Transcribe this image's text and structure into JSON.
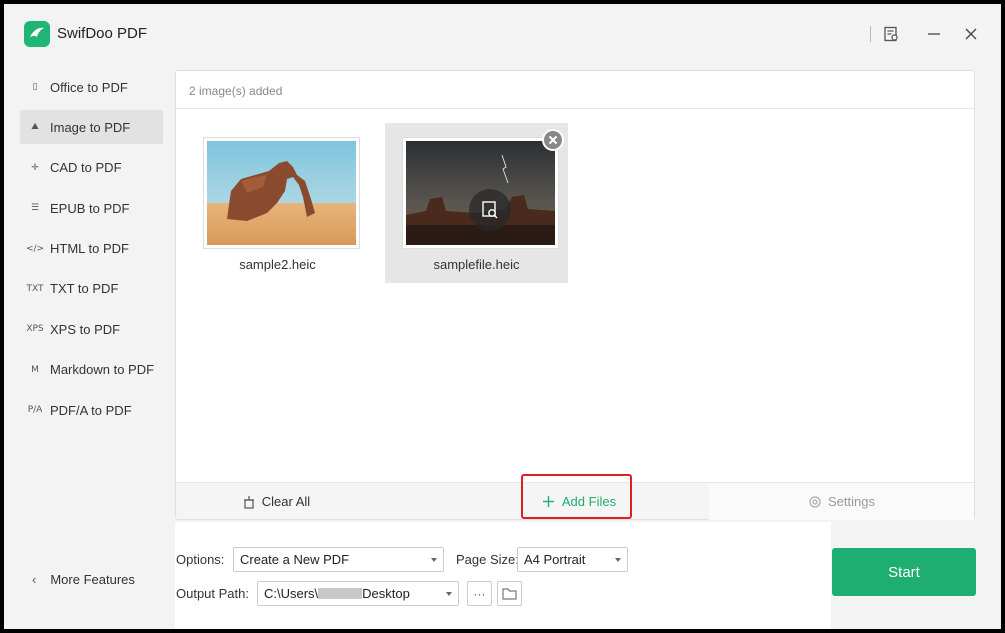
{
  "app": {
    "title": "SwifDoo PDF"
  },
  "sidebar": {
    "items": [
      {
        "icon": "office-icon",
        "glyph": "▯",
        "label": "Office to PDF"
      },
      {
        "icon": "image-icon",
        "glyph": "⛰",
        "label": "Image to PDF"
      },
      {
        "icon": "cad-icon",
        "glyph": "✛",
        "label": "CAD to PDF"
      },
      {
        "icon": "epub-icon",
        "glyph": "☰",
        "label": "EPUB to PDF"
      },
      {
        "icon": "html-icon",
        "glyph": "</>",
        "label": "HTML to PDF"
      },
      {
        "icon": "txt-icon",
        "glyph": "TXT",
        "label": "TXT to PDF"
      },
      {
        "icon": "xps-icon",
        "glyph": "XPS",
        "label": "XPS to PDF"
      },
      {
        "icon": "markdown-icon",
        "glyph": "M",
        "label": "Markdown to PDF"
      },
      {
        "icon": "pdfa-icon",
        "glyph": "P/A",
        "label": "PDF/A to PDF"
      }
    ],
    "active_index": 1,
    "more_label": "More Features"
  },
  "panel": {
    "count_text": "2 image(s) added",
    "files": [
      {
        "name": "sample2.heic",
        "selected": false
      },
      {
        "name": "samplefile.heic",
        "selected": true
      }
    ],
    "clear_label": "Clear All",
    "add_label": "Add Files",
    "settings_label": "Settings"
  },
  "options": {
    "options_label": "Options:",
    "options_value": "Create a New PDF",
    "page_size_label": "Page Size:",
    "page_size_value": "A4 Portrait",
    "output_label": "Output Path:",
    "output_value": "C:\\Users\\",
    "output_value_tail": "Desktop",
    "more_button": "···"
  },
  "start_label": "Start",
  "colors": {
    "accent": "#1fae72",
    "highlight": "#e02020"
  }
}
